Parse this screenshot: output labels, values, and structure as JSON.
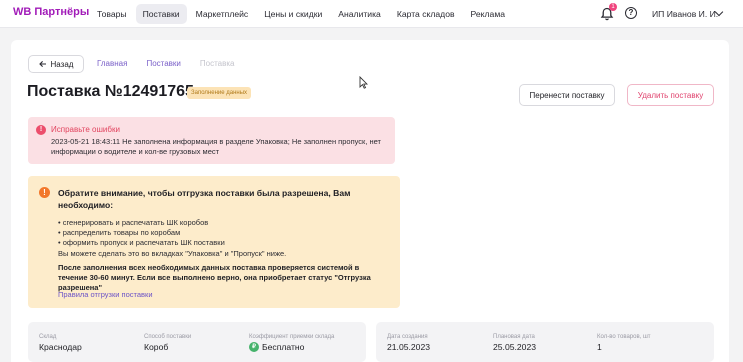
{
  "header": {
    "logo": "WB Партнёры",
    "nav": [
      {
        "label": "Товары"
      },
      {
        "label": "Поставки",
        "active": true
      },
      {
        "label": "Маркетплейс"
      },
      {
        "label": "Цены и скидки"
      },
      {
        "label": "Аналитика"
      },
      {
        "label": "Карта складов"
      },
      {
        "label": "Реклама"
      }
    ],
    "notification_count": "1",
    "help_glyph": "?",
    "user": "ИП Иванов И. И."
  },
  "breadcrumb": {
    "back_label": "Назад",
    "items": [
      "Главная",
      "Поставки",
      "Поставка"
    ]
  },
  "page": {
    "title": "Поставка №12491765",
    "status": "Заполнение данных",
    "move_button": "Перенести поставку",
    "delete_button": "Удалить поставку"
  },
  "error": {
    "icon_glyph": "!",
    "title": "Исправьте ошибки",
    "text": "2023-05-21 18:43:11 Не заполнена информация в разделе Упаковка; Не заполнен пропуск, нет информации о водителе и кол-ве грузовых мест"
  },
  "warning": {
    "icon_glyph": "!",
    "heading": "Обратите внимание, чтобы отгрузка поставки была разрешена, Вам необходимо:",
    "items": [
      "сгенерировать и распечатать ШК коробов",
      "распределить товары по коробам",
      "оформить пропуск и распечатать ШК поставки"
    ],
    "note": "Вы можете сделать это во вкладках \"Упаковка\" и \"Пропуск\" ниже.",
    "bold": "После заполнения всех необходимых данных поставка проверяется системой в течение 30-60 минут. Если все выполнено верно, она приобретает статус \"Отгрузка разрешена\"",
    "link": "Правила отгрузки поставки"
  },
  "details": {
    "warehouse_label": "Склад",
    "warehouse_value": "Краснодар",
    "method_label": "Способ поставки",
    "method_value": "Короб",
    "coef_label": "Коэффициент приемки склада",
    "coef_symbol": "₽",
    "coef_value": "Бесплатно",
    "created_label": "Дата создания",
    "created_value": "21.05.2023",
    "planned_label": "Плановая дата",
    "planned_value": "25.05.2023",
    "count_label": "Кол-во товаров, шт",
    "count_value": "1"
  },
  "colors": {
    "brand": "#a11bb8",
    "link": "#7b61c9",
    "error_bg": "#fbe0e4",
    "warning_bg": "#fdeccb",
    "delete": "#e0436e"
  }
}
